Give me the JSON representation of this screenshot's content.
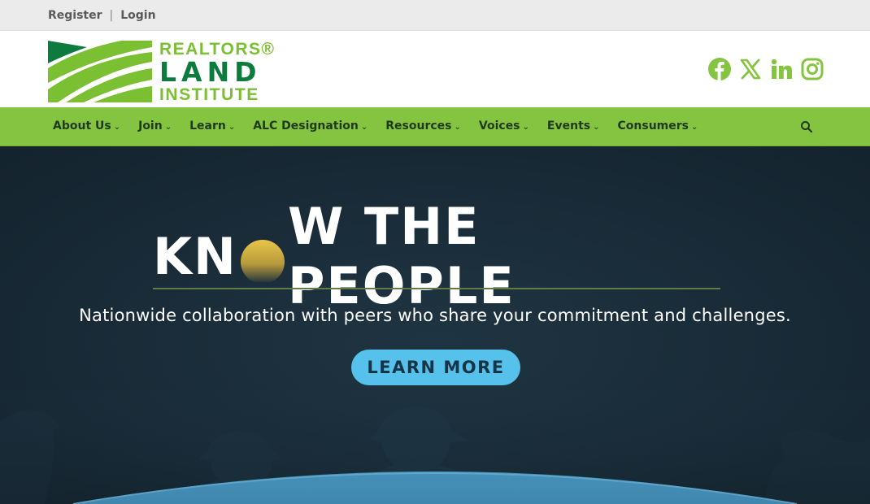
{
  "utility": {
    "register_label": "Register",
    "separator": "|",
    "login_label": "Login"
  },
  "logo": {
    "line1": "REALTORS®",
    "line2": "LAND",
    "line3": "INSTITUTE",
    "colors": {
      "light_green": "#7bbf33",
      "dark_green": "#0d7a3e"
    }
  },
  "social": {
    "icons": [
      "facebook-icon",
      "x-icon",
      "linkedin-icon",
      "instagram-icon"
    ],
    "color": "#85c441"
  },
  "nav": {
    "items": [
      {
        "label": "About Us"
      },
      {
        "label": "Join"
      },
      {
        "label": "Learn"
      },
      {
        "label": "ALC Designation"
      },
      {
        "label": "Resources"
      },
      {
        "label": "Voices"
      },
      {
        "label": "Events"
      },
      {
        "label": "Consumers"
      }
    ],
    "search_icon": "search-icon",
    "background": "#85c441"
  },
  "hero": {
    "title_part1": "KN",
    "title_part2": "W THE PEOPLE",
    "subtitle": "Nationwide collaboration with peers who share your commitment and challenges.",
    "button_label": "LEARN MORE",
    "button_color": "#56c1ea"
  }
}
